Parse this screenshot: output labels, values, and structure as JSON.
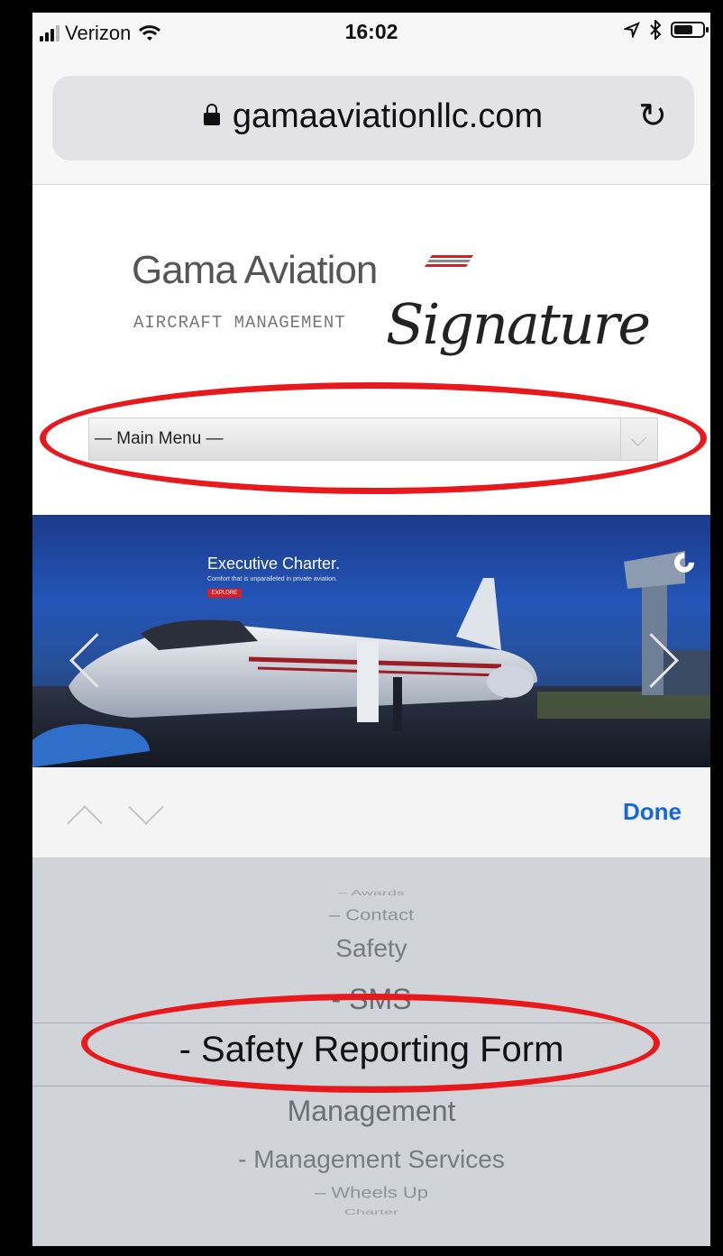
{
  "status_bar": {
    "carrier": "Verizon",
    "time": "16:02",
    "wifi_icon": "wifi-icon",
    "location_icon": "location-arrow-icon",
    "bluetooth_icon": "bluetooth-icon",
    "battery_icon": "battery-icon"
  },
  "browser": {
    "url": "gamaaviationllc.com",
    "lock_icon": "lock-icon",
    "reload_icon": "reload-icon"
  },
  "site": {
    "brand_name": "Gama Aviation",
    "brand_sub": "AIRCRAFT MANAGEMENT",
    "brand_signature": "Signature",
    "menu_select_value": "— Main Menu —",
    "hero": {
      "headline": "Executive Charter.",
      "tagline": "Comfort that is unparalleled in private aviation.",
      "button": "EXPLORE"
    }
  },
  "toolbar": {
    "done_label": "Done"
  },
  "picker": {
    "items": [
      "– Awards",
      "– Contact",
      "Safety",
      "- SMS",
      "- Safety Reporting Form",
      "Management",
      "- Management Services",
      "– Wheels Up",
      "Charter"
    ],
    "selected": "- Safety Reporting Form"
  },
  "colors": {
    "annotation": "#e8191d",
    "done": "#1667d9",
    "picker_bg": "#d0d4d9"
  }
}
